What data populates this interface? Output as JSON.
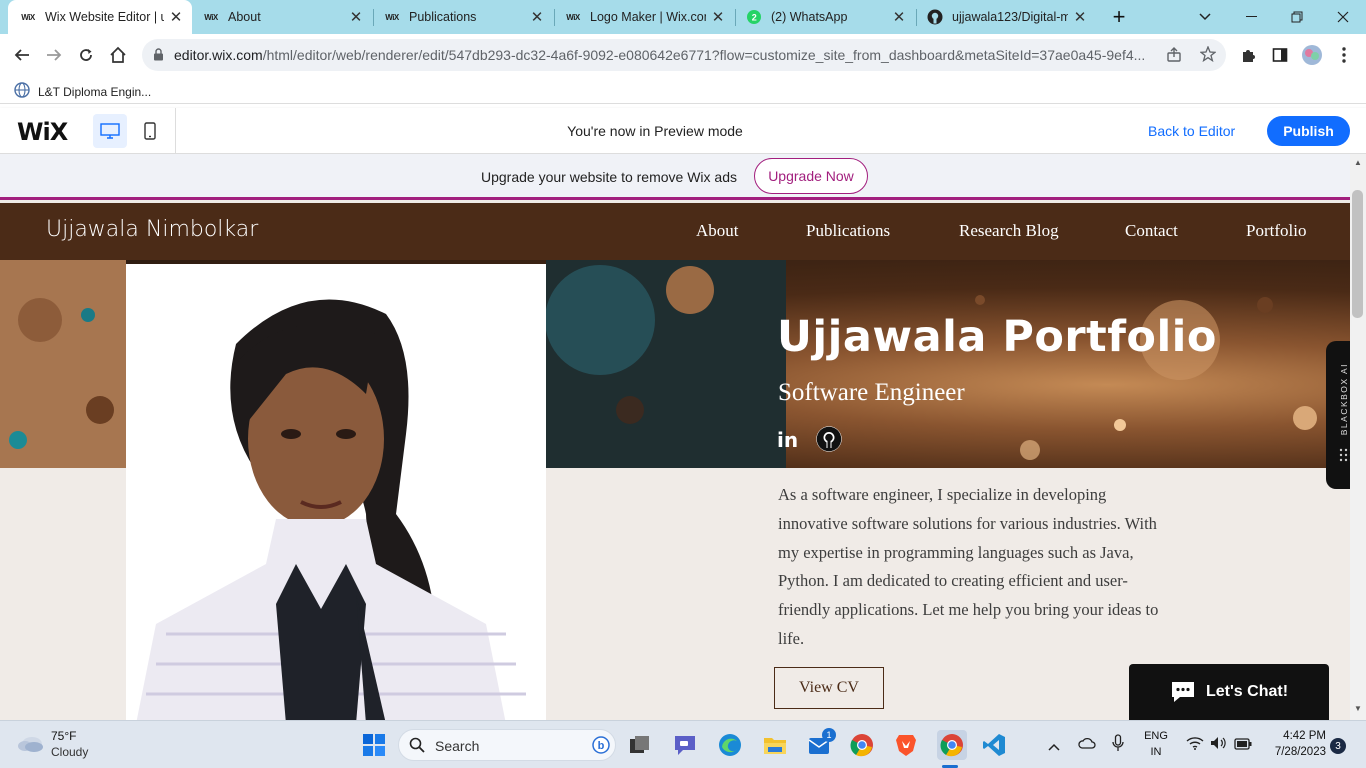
{
  "browser": {
    "tabs": [
      {
        "title": "Wix Website Editor | u",
        "icon": "wix-favicon"
      },
      {
        "title": "About",
        "icon": "wix-favicon"
      },
      {
        "title": "Publications",
        "icon": "wix-favicon"
      },
      {
        "title": "Logo Maker | Wix.com",
        "icon": "wix-favicon"
      },
      {
        "title": "(2) WhatsApp",
        "icon": "whatsapp-favicon"
      },
      {
        "title": "ujjawala123/Digital-m",
        "icon": "github-favicon"
      }
    ],
    "url_host": "editor.wix.com",
    "url_rest": "/html/editor/web/renderer/edit/547db293-dc32-4a6f-9092-e080642e6771?flow=customize_site_from_dashboard&metaSiteId=37ae0a45-9ef4...",
    "bookmark": "L&T Diploma Engin..."
  },
  "wix_bar": {
    "logo": "WiX",
    "message": "You're now in Preview mode",
    "back_label": "Back to Editor",
    "publish_label": "Publish"
  },
  "ad": {
    "text": "Upgrade your website to remove Wix ads",
    "button": "Upgrade Now"
  },
  "site": {
    "name": "Ujjawala Nimbolkar",
    "nav": [
      "About",
      "Publications",
      "Research Blog",
      "Contact",
      "Portfolio"
    ],
    "hero_title": "Ujjawala Portfolio",
    "hero_subtitle": "Software Engineer",
    "bio": "As a software engineer, I specialize in developing innovative software solutions for various industries. With my expertise in programming languages such as Java, Python. I am dedicated to creating efficient and user-friendly applications. Let me help you bring your ideas to life.",
    "cv_button": "View CV",
    "chat_label": "Let's Chat!",
    "side_widget": "BLACKBOX AI",
    "social": [
      "linkedin-icon",
      "github-icon"
    ]
  },
  "taskbar": {
    "weather_temp": "75°F",
    "weather_desc": "Cloudy",
    "search_label": "Search",
    "lang_top": "ENG",
    "lang_bottom": "IN",
    "time": "4:42 PM",
    "date": "7/28/2023",
    "notif_count": "3",
    "outlook_badge": "1"
  },
  "colors": {
    "tab_strip": "#a6dcea",
    "wix_blue": "#116dff",
    "site_brown": "#4b2b17",
    "ad_accent": "#a21f7e",
    "page_bg": "#f0ebe7"
  }
}
